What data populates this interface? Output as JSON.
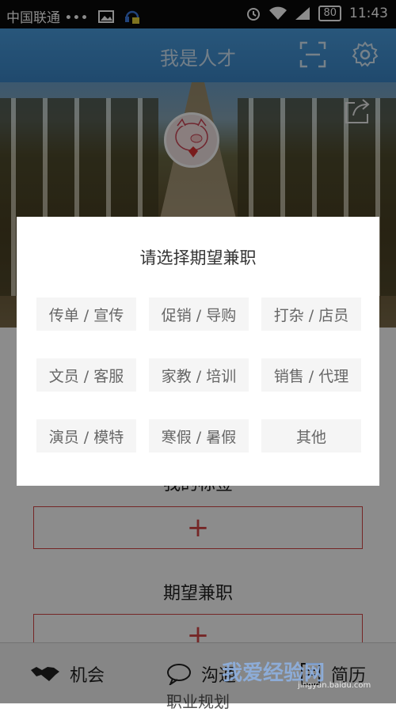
{
  "status_bar": {
    "carrier": "中国联通 •••",
    "battery": "80",
    "time": "11:43"
  },
  "app_bar": {
    "title": "我是人才"
  },
  "sections": {
    "tag_title": "我的标签",
    "expect_title": "期望兼职",
    "career_title": "职业规划",
    "add_symbol": "+"
  },
  "tabs": [
    {
      "label": "机会",
      "icon": "handshake-icon"
    },
    {
      "label": "沟通",
      "icon": "chat-bubble-icon"
    },
    {
      "label": "简历",
      "icon": "resume-icon"
    }
  ],
  "dialog": {
    "title": "请选择期望兼职",
    "options": [
      "传单 / 宣传",
      "促销 / 导购",
      "打杂 / 店员",
      "文员 / 客服",
      "家教 / 培训",
      "销售 / 代理",
      "演员 / 模特",
      "寒假 / 暑假",
      "其他"
    ]
  },
  "watermark": {
    "text": "我爱经验网",
    "url": "jingyan.baidu.com"
  },
  "colors": {
    "app_bar": "#3a86c8",
    "add_accent": "#d64545",
    "option_bg": "#f5f5f5"
  }
}
